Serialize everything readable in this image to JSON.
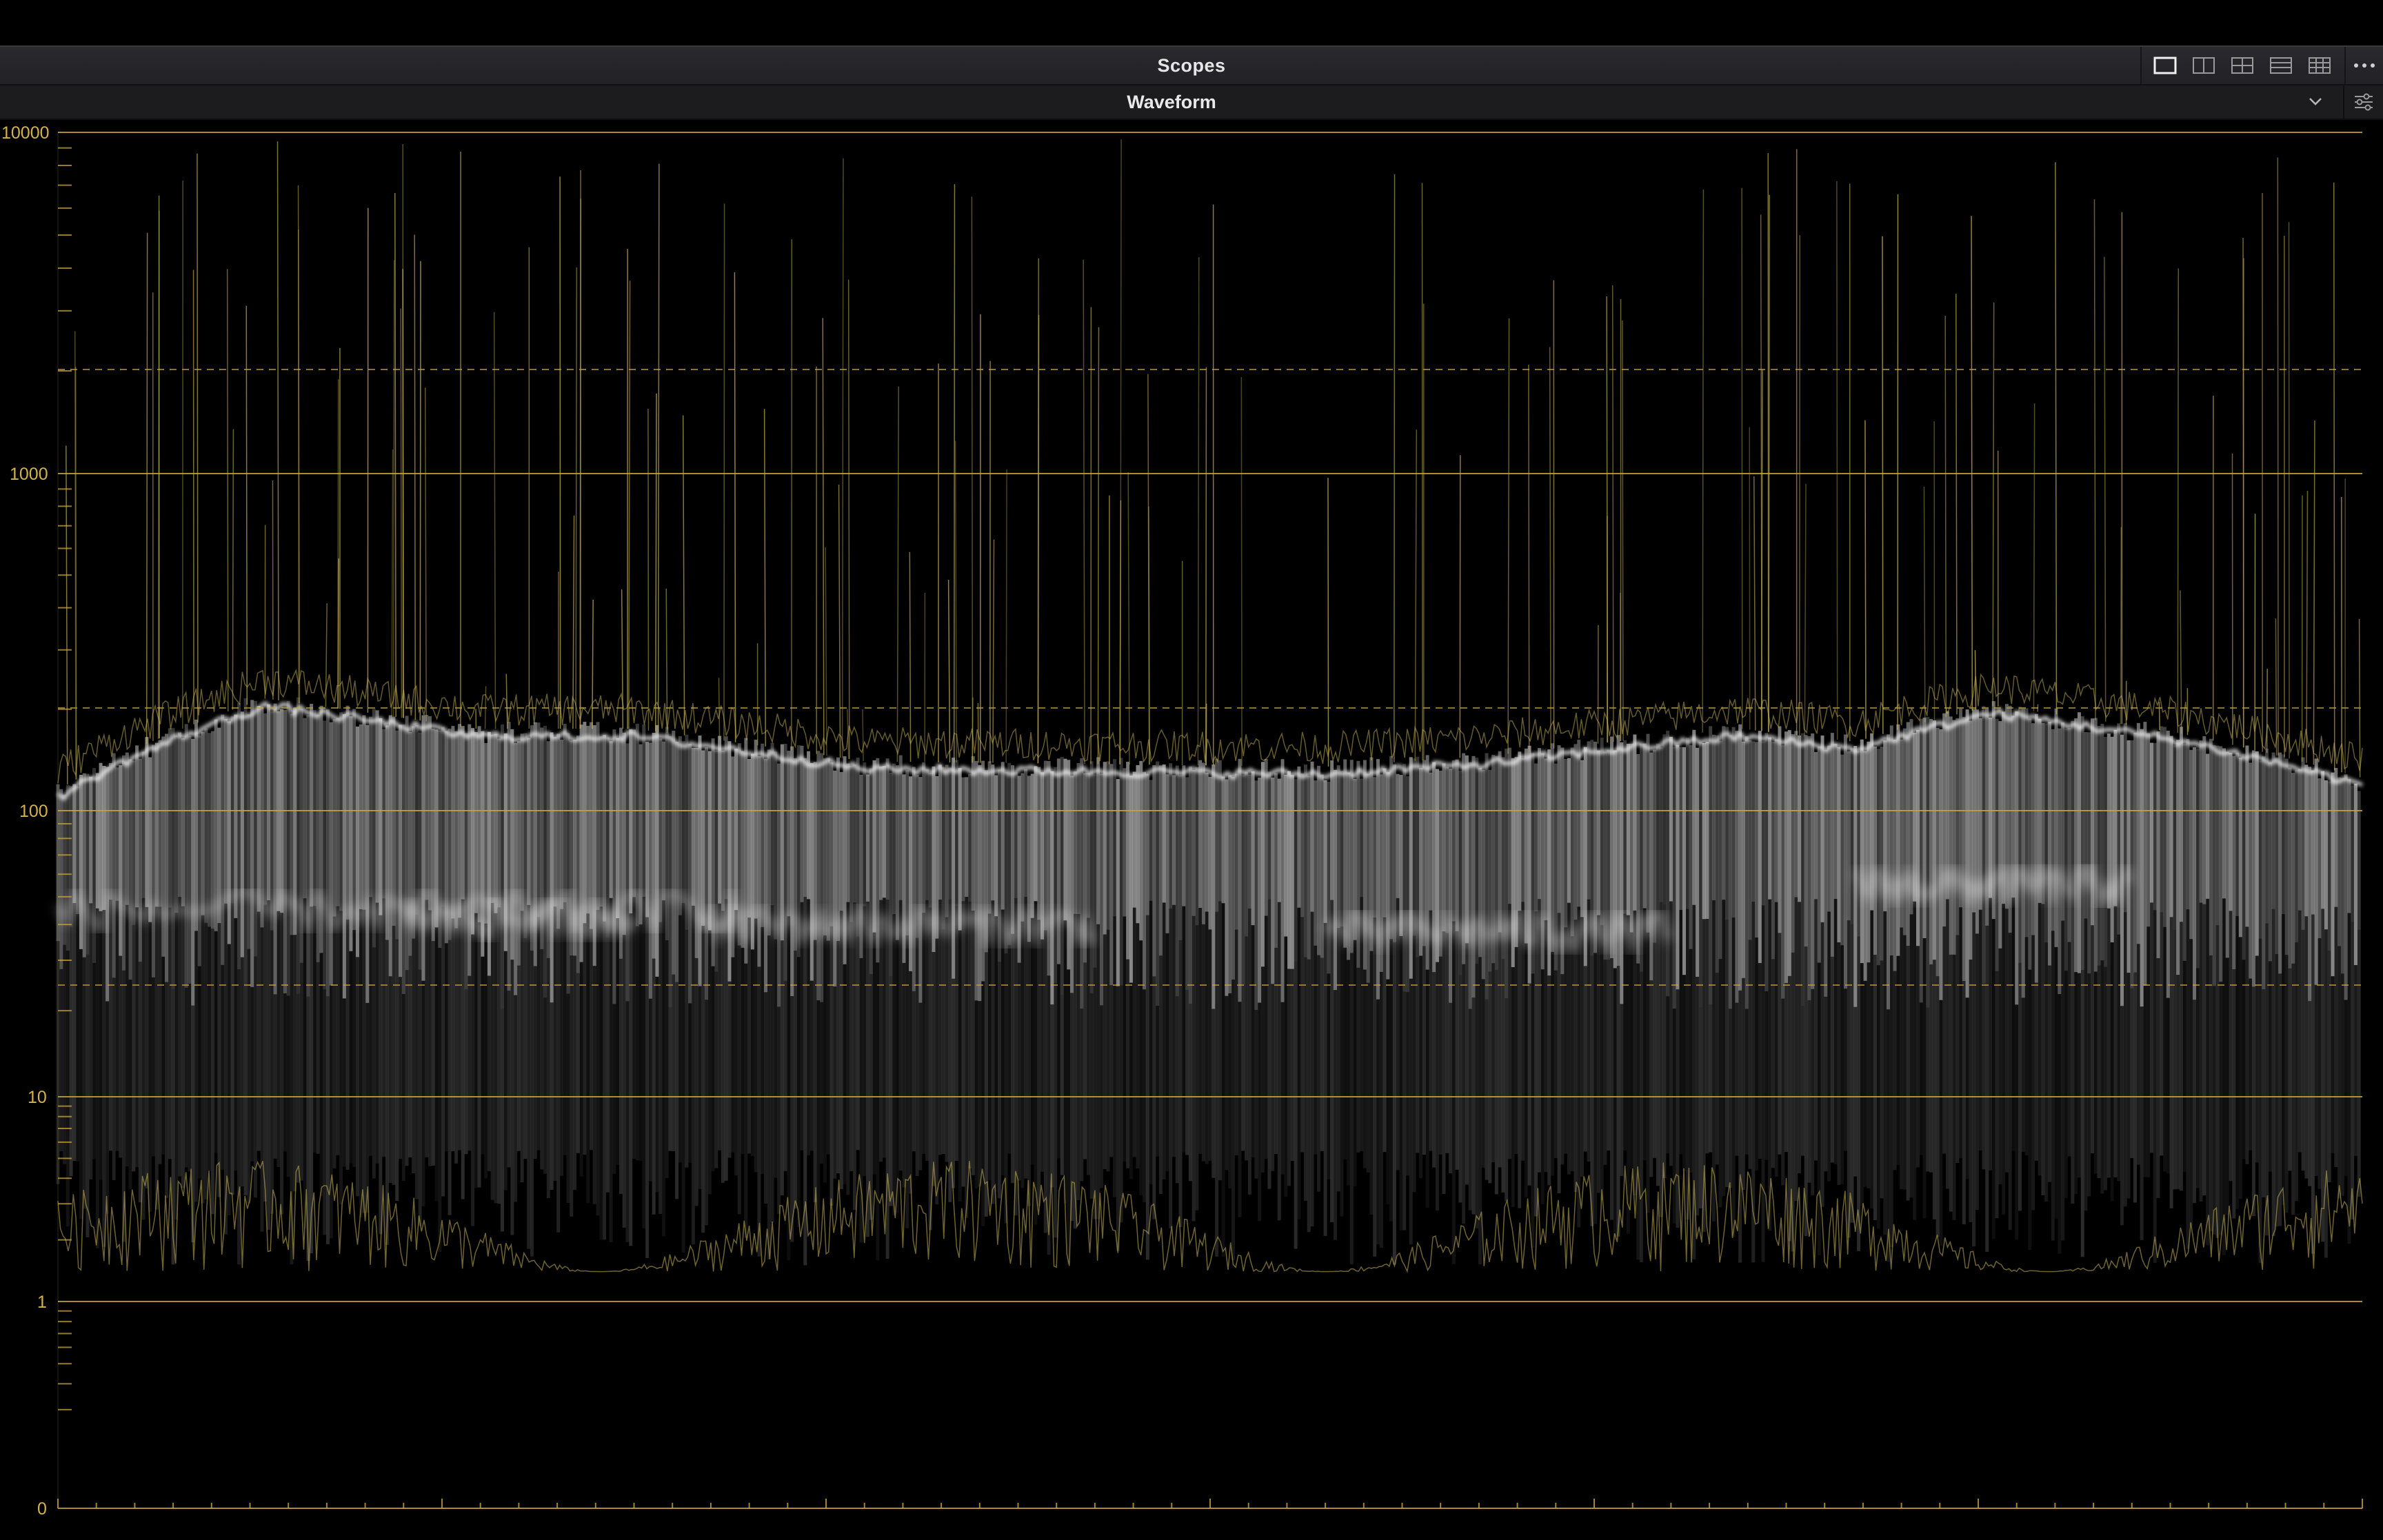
{
  "panel": {
    "title": "Scopes",
    "layout_buttons": [
      {
        "icon": "single-view-icon",
        "selected": true
      },
      {
        "icon": "two-up-view-icon",
        "selected": false
      },
      {
        "icon": "quad-view-icon",
        "selected": false
      },
      {
        "icon": "stacked-view-icon",
        "selected": false
      },
      {
        "icon": "grid-view-icon",
        "selected": false
      }
    ],
    "more_icon": "more-options-icon"
  },
  "mode": {
    "selected": "Waveform",
    "dropdown_icon": "chevron-down-icon",
    "settings_icon": "scope-settings-icon"
  },
  "scope": {
    "scale": "log (nits)",
    "tick_labels": {
      "t10000": "10000",
      "t1000": "1000",
      "t100": "100",
      "t10": "10",
      "t1": "1",
      "t0": "0"
    },
    "solid_lines": [
      10000,
      1000,
      100,
      10,
      1
    ],
    "dashed_lines": [
      2000,
      200,
      25
    ],
    "colors": {
      "graticule": "#c9a43c",
      "trace": "#ffffff",
      "trace_accent": "#c8b45a",
      "background": "#000000"
    }
  }
}
